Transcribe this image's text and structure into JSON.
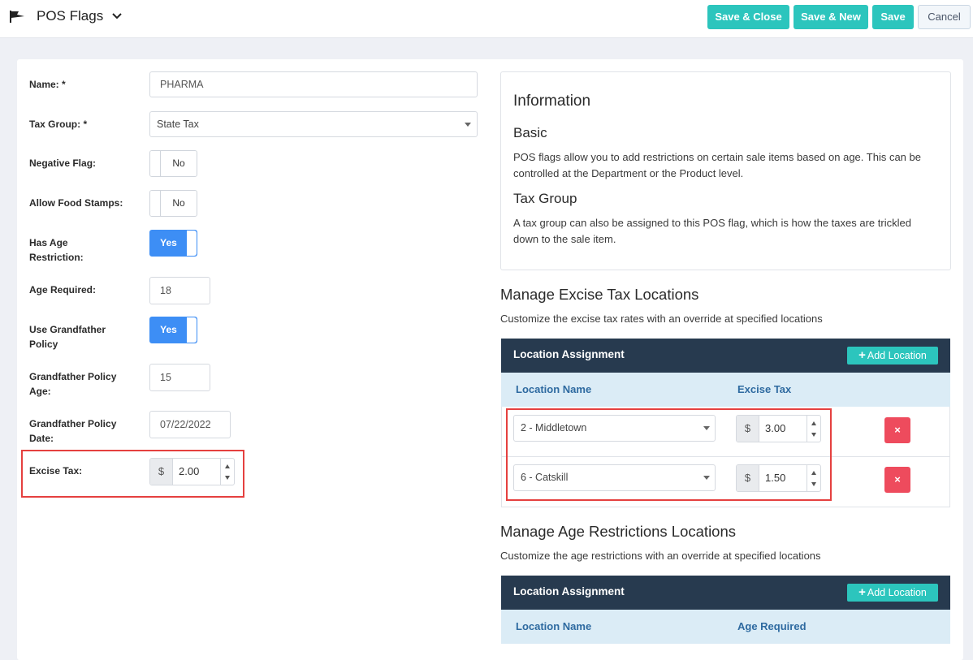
{
  "header": {
    "title": "POS Flags",
    "buttons": {
      "save_close": "Save & Close",
      "save_new": "Save & New",
      "save": "Save",
      "cancel": "Cancel"
    }
  },
  "form": {
    "name_label": "Name: *",
    "name_value": "PHARMA",
    "tax_group_label": "Tax Group: *",
    "tax_group_value": "State Tax",
    "negative_flag_label": "Negative Flag:",
    "negative_flag_value": "No",
    "food_stamps_label": "Allow Food Stamps:",
    "food_stamps_value": "No",
    "age_restriction_label": "Has Age Restriction:",
    "age_restriction_value": "Yes",
    "age_required_label": "Age Required:",
    "age_required_value": "18",
    "grandfather_label": "Use Grandfather Policy",
    "grandfather_value": "Yes",
    "gf_age_label": "Grandfather Policy Age:",
    "gf_age_value": "15",
    "gf_date_label": "Grandfather Policy Date:",
    "gf_date_value": "07/22/2022",
    "excise_label": "Excise Tax:",
    "excise_currency": "$",
    "excise_value": "2.00"
  },
  "info": {
    "title": "Information",
    "basic_title": "Basic",
    "basic_text": "POS flags allow you to add restrictions on certain sale items based on age. This can be controlled at the Department or the Product level.",
    "tax_title": "Tax Group",
    "tax_text": "A tax group can also be assigned to this POS flag, which is how the taxes are trickled down to the sale item."
  },
  "excise_section": {
    "title": "Manage Excise Tax Locations",
    "desc": "Customize the excise tax rates with an override at specified locations",
    "panel_title": "Location Assignment",
    "add_label": "Add Location",
    "col_location": "Location Name",
    "col_tax": "Excise Tax",
    "rows": [
      {
        "location": "2 - Middletown",
        "currency": "$",
        "tax": "3.00",
        "delete": "×"
      },
      {
        "location": "6 - Catskill",
        "currency": "$",
        "tax": "1.50",
        "delete": "×"
      }
    ]
  },
  "age_section": {
    "title": "Manage Age Restrictions Locations",
    "desc": "Customize the age restrictions with an override at specified locations",
    "panel_title": "Location Assignment",
    "add_label": "Add Location",
    "col_location": "Location Name",
    "col_age": "Age Required"
  }
}
